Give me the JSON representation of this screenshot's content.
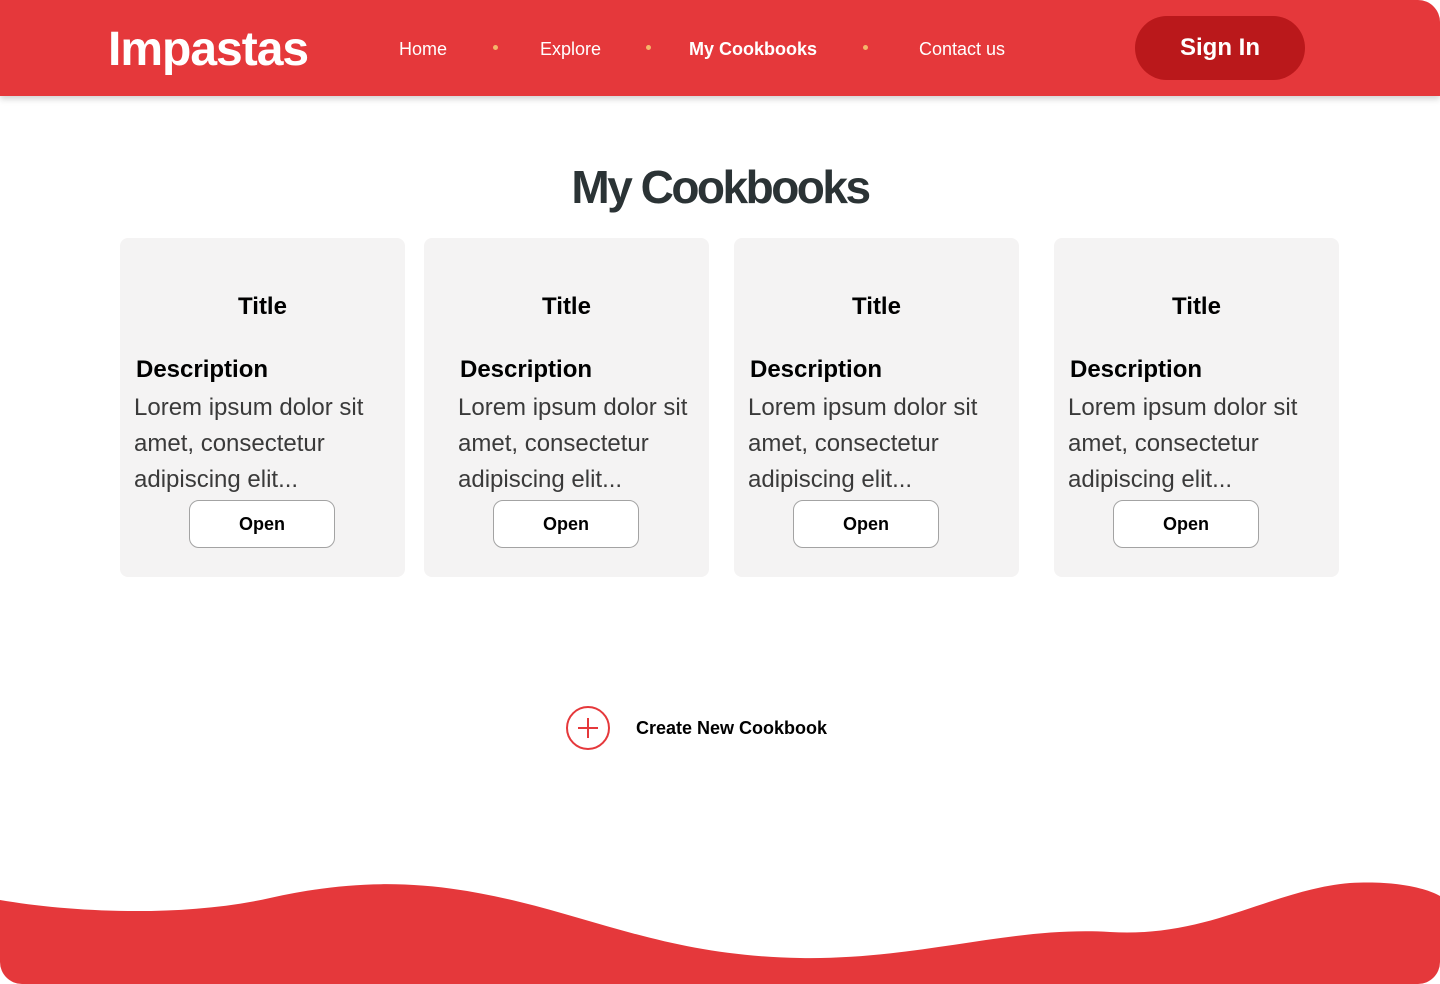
{
  "header": {
    "logo": "Impastas",
    "nav": [
      {
        "label": "Home"
      },
      {
        "label": "Explore"
      },
      {
        "label": "My Cookbooks",
        "active": true
      },
      {
        "label": "Contact us"
      }
    ],
    "signin_label": "Sign In"
  },
  "main": {
    "title": "My Cookbooks",
    "cards": [
      {
        "title": "Title",
        "desc_label": "Description",
        "desc": "Lorem ipsum dolor sit amet, consectetur adipiscing elit...",
        "button": "Open"
      },
      {
        "title": "Title",
        "desc_label": "Description",
        "desc": "Lorem ipsum dolor sit amet, consectetur adipiscing elit...",
        "button": "Open"
      },
      {
        "title": "Title",
        "desc_label": "Description",
        "desc": "Lorem ipsum dolor sit amet, consectetur adipiscing elit...",
        "button": "Open"
      },
      {
        "title": "Title",
        "desc_label": "Description",
        "desc": "Lorem ipsum dolor sit amet, consectetur adipiscing elit...",
        "button": "Open"
      }
    ],
    "create_label": "Create New Cookbook",
    "create_icon": "plus-circle-icon"
  },
  "colors": {
    "primary": "#e5383b",
    "primary_dark": "#ba181b",
    "nav_dot": "#f4b66a",
    "card_bg": "#f4f3f3",
    "title_text": "#2b3335"
  }
}
